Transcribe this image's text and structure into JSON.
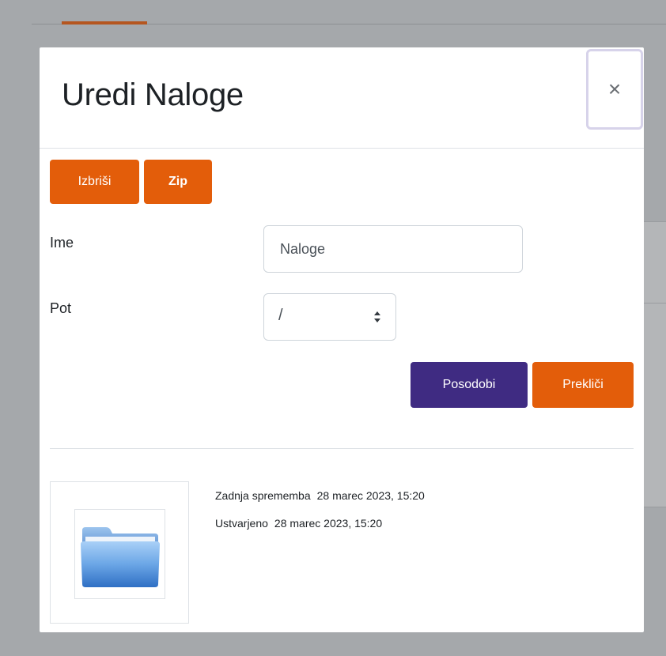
{
  "dialog": {
    "title": "Uredi Naloge",
    "close_label": "×"
  },
  "actions": {
    "delete_label": "Izbriši",
    "zip_label": "Zip"
  },
  "form": {
    "name_label": "Ime",
    "name_value": "Naloge",
    "path_label": "Pot",
    "path_value": "/"
  },
  "footer_buttons": {
    "update_label": "Posodobi",
    "cancel_label": "Prekliči"
  },
  "details": {
    "modified_label": "Zadnja sprememba",
    "modified_value": "28 marec 2023, 15:20",
    "created_label": "Ustvarjeno",
    "created_value": "28 marec 2023, 15:20",
    "preview_icon": "folder-icon"
  },
  "colors": {
    "primary_orange": "#e35d0a",
    "primary_purple": "#3f2b82",
    "overlay": "#a8abae"
  }
}
